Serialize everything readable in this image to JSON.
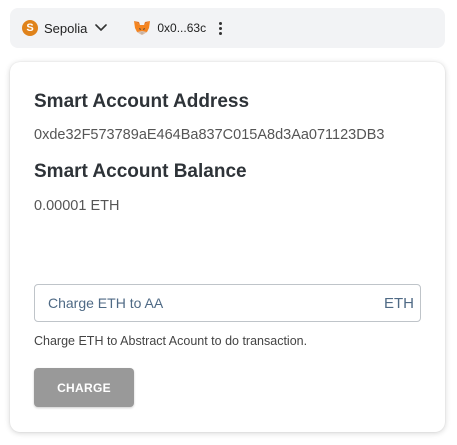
{
  "header": {
    "network": {
      "badge": "S",
      "name": "Sepolia",
      "badge_color": "#e0831b"
    },
    "account": {
      "address": "0x0...63c",
      "icon": "metamask-fox-icon"
    },
    "more_icon": "kebab-menu-icon"
  },
  "card": {
    "address_title": "Smart Account Address",
    "address_value": "0xde32F573789aE464Ba837C015A8d3Aa071123DB3",
    "balance_title": "Smart Account Balance",
    "balance_value": "0.00001 ETH",
    "charge_field": {
      "placeholder": "Charge ETH to AA",
      "value": "",
      "unit": "ETH"
    },
    "helper_text": "Charge ETH to Abstract Acount to do transaction.",
    "charge_button": "CHARGE",
    "button_color": "#999999"
  }
}
